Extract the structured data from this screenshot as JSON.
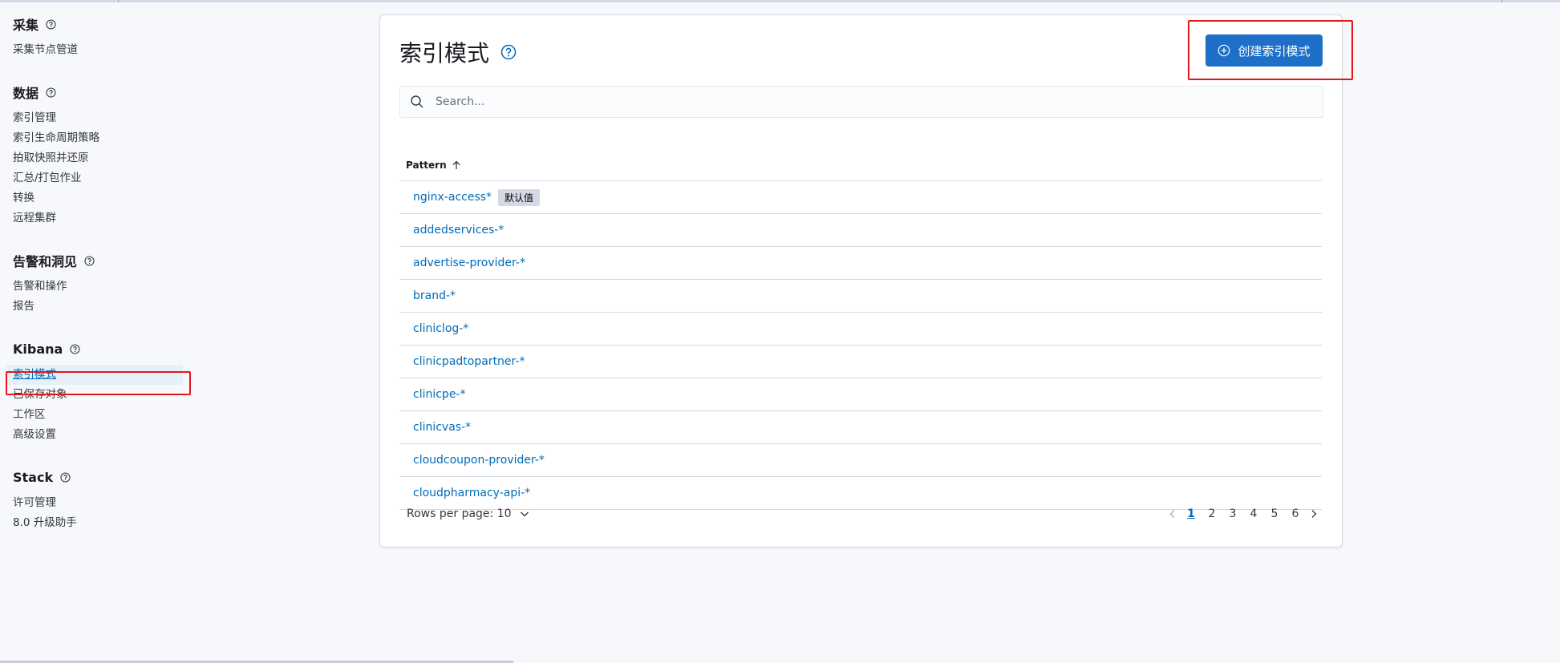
{
  "sidebar": {
    "groups": [
      {
        "title": "采集",
        "items": [
          "采集节点管道"
        ]
      },
      {
        "title": "数据",
        "items": [
          "索引管理",
          "索引生命周期策略",
          "拍取快照并还原",
          "汇总/打包作业",
          "转换",
          "远程集群"
        ]
      },
      {
        "title": "告警和洞见",
        "items": [
          "告警和操作",
          "报告"
        ]
      },
      {
        "title": "Kibana",
        "items": [
          "索引模式",
          "已保存对象",
          "工作区",
          "高级设置"
        ]
      },
      {
        "title": "Stack",
        "items": [
          "许可管理",
          "8.0 升级助手"
        ]
      }
    ]
  },
  "panel": {
    "title": "索引模式",
    "create_label": "创建索引模式",
    "search_placeholder": "Search...",
    "column_header": "Pattern",
    "rows": [
      {
        "name": "nginx-access*",
        "badge": "默认值"
      },
      {
        "name": "addedservices-*"
      },
      {
        "name": "advertise-provider-*"
      },
      {
        "name": "brand-*"
      },
      {
        "name": "cliniclog-*"
      },
      {
        "name": "clinicpadtopartner-*"
      },
      {
        "name": "clinicpe-*"
      },
      {
        "name": "clinicvas-*"
      },
      {
        "name": "cloudcoupon-provider-*"
      },
      {
        "name": "cloudpharmacy-api-*"
      }
    ],
    "rows_per_page": "Rows per page: 10",
    "pages": [
      "1",
      "2",
      "3",
      "4",
      "5",
      "6"
    ],
    "current_page": "1"
  },
  "colors": {
    "accent": "#1d6fc7",
    "link": "#006bb8",
    "highlight": "#e3171a"
  },
  "icons": [
    "help-icon",
    "plus-circle-icon",
    "search-icon",
    "sort-up-icon",
    "chevron-down-icon",
    "chevron-left-icon",
    "chevron-right-icon"
  ]
}
